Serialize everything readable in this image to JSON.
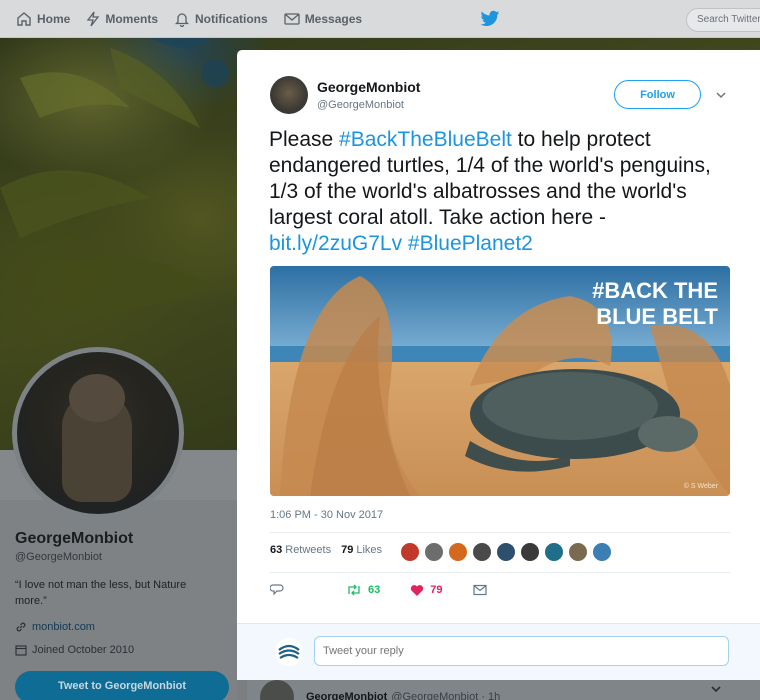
{
  "nav": {
    "home": "Home",
    "moments": "Moments",
    "notifications": "Notifications",
    "messages": "Messages",
    "search_placeholder": "Search Twitter"
  },
  "profile": {
    "name": "GeorgeMonbiot",
    "handle": "@GeorgeMonbiot",
    "bio": "“I love not man the less, but Nature more.”",
    "link": "monbiot.com",
    "joined": "Joined October 2010",
    "tweet_to_label": "Tweet to GeorgeMonbiot"
  },
  "tweet": {
    "name": "GeorgeMonbiot",
    "handle": "@GeorgeMonbiot",
    "follow_label": "Follow",
    "text_parts": {
      "p1": "Please ",
      "hashtag1": "#BackTheBlueBelt",
      "p2": " to help protect endangered turtles, 1/4 of the world's penguins, 1/3 of the world's albatrosses and the world's largest coral atoll. Take action here - ",
      "url": "bit.ly/2zuG7Lv",
      "p3": " ",
      "hashtag2": "#BluePlanet2"
    },
    "media": {
      "overlay_line1": "#BACK THE",
      "overlay_line2": "BLUE BELT",
      "credit": "© S Weber"
    },
    "timestamp": "1:06 PM - 30 Nov 2017",
    "retweets_count": "63",
    "retweets_label": "Retweets",
    "likes_count": "79",
    "likes_label": "Likes",
    "likers": [
      "#c0392b",
      "#6d6d6d",
      "#d2691e",
      "#4a4a4a",
      "#2f4f6f",
      "#3a3a3a",
      "#1f6f8b",
      "#7a6a4f",
      "#3b7fb4"
    ],
    "actions": {
      "retweet_count": "63",
      "like_count": "79"
    },
    "reply_placeholder": "Tweet your reply"
  },
  "background_tweet": {
    "name": "GeorgeMonbiot",
    "handle_time": "@GeorgeMonbiot · 1h"
  },
  "colors": {
    "twitter_blue": "#1da1f2",
    "link_blue": "#1b95e0",
    "retweet_green": "#17bf63",
    "like_red": "#e0245e"
  }
}
